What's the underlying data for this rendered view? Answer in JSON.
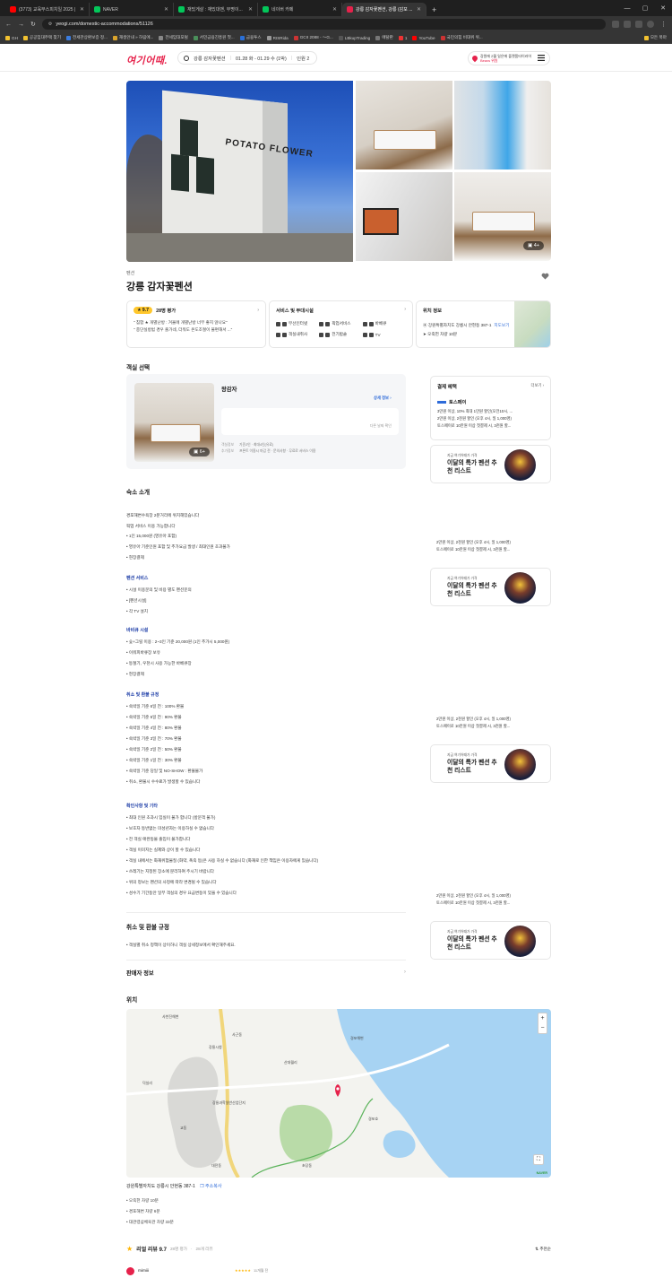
{
  "browser": {
    "tabs": [
      {
        "label": "(3773) 교육부스피치일 2025 |",
        "color": "#ff0000",
        "active": false
      },
      {
        "label": "NAVER",
        "color": "#03c75a",
        "active": false
      },
      {
        "label": "재밌게살 : 재밌대맨, 무명이...",
        "color": "#03c75a",
        "active": false
      },
      {
        "label": "네이버 카페",
        "color": "#03c75a",
        "active": false
      },
      {
        "label": "강릉 감자꽃펜션, 강릉 (감포 ...",
        "color": "#e6224b",
        "active": true
      }
    ],
    "url": "yeogi.com/domestic-accommodations/51126",
    "bookmarks": [
      "GH",
      "공공임대주택 찾기",
      "전세관상환보증 정...",
      "재생안내 » 하림에...",
      "전세임대포털",
      "서민금융진흥원 첫...",
      "금융투스",
      "RISRida",
      "GCII 2088 - 〜G...",
      "LBkupTrading",
      "에탈판",
      "1",
      "YouTube",
      "국민의힘 비대위 위..."
    ],
    "bookmarks_folder": "모든 북마"
  },
  "header": {
    "logo": "여기어때.",
    "search_place": "강릉 감자꽃펜션",
    "search_dates": "01.28 화 - 01.29 수 (1박)",
    "search_people": "인원 2",
    "promo_line1": "강원에 2월 일은에 플랫폼타이러어",
    "promo_line2": "Beaxs 위원"
  },
  "gallery": {
    "photo_count": "4+",
    "sign_text": "POTATO FLOWER"
  },
  "property": {
    "category": "펜션",
    "name": "강릉 감자꽃펜션"
  },
  "rating_card": {
    "score": "9.7",
    "review_count": "28명 평가",
    "snippets": [
      "\" 침합 ★ 개별난방 : 겨울에 개별난방 너무 좋지 않나요\"",
      "\" 충단실방범 경우 출가네, 더워도 온도조절이 불편해서 ...\""
    ]
  },
  "service_card": {
    "title": "서비스 및 부대시설",
    "items": [
      "무선인터넷",
      "픽업서비스",
      "바베큐",
      "객실내취사",
      "전기밥솥",
      "TV"
    ]
  },
  "location_card": {
    "title": "위치 정보",
    "address": "강원특별자치도 강릉시 안현동 387-1",
    "copy_label": "지도보기",
    "distance": "오죽헌 차량 10분"
  },
  "rooms": {
    "section_title": "객실 선택",
    "room_name": "왕감자",
    "detail_link": "상세 정보",
    "price_note": "다른 날짜 확인",
    "photo_count": "6+",
    "meta": [
      {
        "k": "객실정보",
        "v": "기준2인 · 최대4인(유료)"
      },
      {
        "k": "추가정보",
        "v": "프론트 이용시 마감 전 · 문의사항 · 무료로 서비스 이용"
      }
    ]
  },
  "benefits": {
    "title": "결제 혜택",
    "more": "더보기",
    "brand": "토스페이",
    "lines": [
      "3만원 이상, 10% 최대 1만원 할인(오전10시, ...",
      "2만원 이상, 2천원 할인 (오후 4시, 일 1,000명)",
      "토스페이로 10만원 이상 첫결제 시, 3천원 할..."
    ],
    "repeat_lines": [
      "2만원 이상, 2천원 할인 (오후 4시, 일 1,000명)",
      "토스페이로 10만원 이상 첫결제 시, 3천원 할..."
    ]
  },
  "promo_card": {
    "sub": "지금 여기어때가 가격",
    "main": "이달의 특가 펜션 추천 리스트"
  },
  "about": {
    "section_title": "숙소 소개",
    "intro": [
      "경포해변수욕장 2분거리에 위치해있습니다",
      "픽업 서비스 이용 가능합니다"
    ],
    "basic": [
      "1인 15,000원 (영유아 포함)",
      "영유아 기준인원 포함 및 추가요금 발생 / 최대인원 초과불가",
      "현장결제"
    ],
    "services_title": "펜션 서비스",
    "services": [
      "시설 이용문의 및 비용 별도 펜션문의",
      "[펜션시설]",
      "각 TV 설치"
    ],
    "bbq_title": "바비큐 시설",
    "bbq": [
      "숯+그릴 이용 : 2~3인 기준 20,000원 (1인 추가시 5,000원)",
      "이워피바큐장 보유",
      "동절기, 우천시 사용 가능한 바베큐장",
      "현장결제"
    ],
    "refund_title": "취소 및 환불 규정",
    "refund": [
      "숙박일 기준 6일 전 : 100% 환불",
      "숙박일 기준 5일 전 : 90% 환불",
      "숙박일 기준 4일 전 : 80% 환불",
      "숙박일 기준 3일 전 : 70% 환불",
      "숙박일 기준 2일 전 : 50% 환불",
      "숙박일 기준 1일 전 : 30% 환불",
      "숙박일 기준 당일 및 NO-SHOW : 환불불가",
      "취소, 환불시 수수료가 발생할 수 있습니다"
    ],
    "notice_title": "확인사항 및 기타",
    "notice": [
      "최대 인원 초과시 입실이 불가 합니다 (방문객 불가)",
      "보호자 동반없는 미성년자는 이용하실 수 없습니다",
      "전 객실 애완동물 출입이 불가합니다",
      "객실 이미지는 실제와 상이 할 수 있습니다",
      "객실 내에서는 화재위험물질 (화약, 폭죽 등)은 사용 하실 수 없습니다 (화재로 인한 책임은 이용자에게 있습니다)",
      "쓰레기는 지정된 장소에 분리하여 주시기 바랍니다",
      "위의 정보는 펜션의 사정에 따라 변경될 수 있습니다",
      "성수기 기간동안 일부 객실의 경우 요금변동이 있을 수 있습니다"
    ]
  },
  "refund_section": {
    "title": "취소 및 환불 규정",
    "text": "객실별 취소 정책이 상이하니 객실 상세정보에서 확인해주세요."
  },
  "seller": {
    "title": "판매자 정보"
  },
  "map": {
    "section_title": "위치",
    "labels": [
      "사천진해변",
      "사근동",
      "강릉시청",
      "산대월리",
      "덕실리",
      "강릉과학일반산업단지",
      "경포해변",
      "경포호",
      "대전동",
      "초당동",
      "교동",
      "NAVER"
    ],
    "address": "강원특별자치도 강릉시 안현동 387-1",
    "copy_label": "주소복사",
    "nearby": [
      "오죽헌 차량 10분",
      "경포해변 차량 6분",
      "대관령삼체육관 차량 33분"
    ]
  },
  "reviews": {
    "title": "리얼 리뷰 9.7",
    "count": "28명 평가",
    "count_sub": "28개 리뷰",
    "sort": "추천순",
    "user": "mimiii",
    "stars": "★★★★★",
    "date": "11개월 전"
  }
}
